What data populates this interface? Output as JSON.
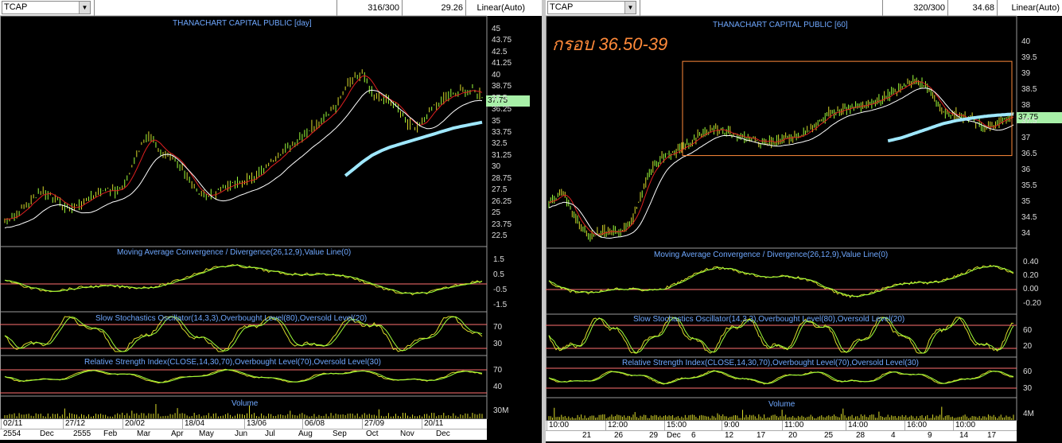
{
  "colors": {
    "price": "#9dff3a",
    "ma_fast": "#e02020",
    "ma_mid": "#ffffff",
    "ma_long": "#9fe8ff",
    "indicator": "#dada2a",
    "indicator2": "#9dff3a",
    "level": "#ff6f6f",
    "title": "#6fa8ff",
    "volume": "#dada2a",
    "annotation": "#ff8a3a",
    "price_tag": "#a8f0a8"
  },
  "left": {
    "symbol": "TCAP",
    "count": "316/300",
    "last": "29.26",
    "scale": "Linear(Auto)",
    "title": "THANACHART CAPITAL PUBLIC [day]",
    "price_tag": "37.75",
    "price_ticks": [
      "45",
      "43.75",
      "42.5",
      "41.25",
      "40",
      "38.75",
      "37.5",
      "36.25",
      "35",
      "33.75",
      "32.5",
      "31.25",
      "30",
      "28.75",
      "27.5",
      "26.25",
      "25",
      "23.75",
      "22.5"
    ],
    "macd_title": "Moving Average Convergence / Divergence(26,12,9),Value Line(0)",
    "macd_ticks": [
      "1.5",
      "0.5",
      "-0.5",
      "-1.5"
    ],
    "stoch_title": "Slow Stochastics Oscillator(14,3,3),Overbought Level(80),Oversold Level(20)",
    "stoch_ticks": [
      "70",
      "30"
    ],
    "rsi_title": "Relative Strength Index(CLOSE,14,30,70),Overbought Level(70),Oversold Level(30)",
    "rsi_ticks": [
      "70",
      "40"
    ],
    "vol_title": "Volume",
    "vol_ticks": [
      "30M"
    ],
    "x_top": [
      "02/11",
      "27/12",
      "20/02",
      "18/04",
      "13/06",
      "06/08",
      "27/09",
      "20/11"
    ],
    "x_bottom": [
      "2554",
      "Dec",
      "2555",
      "Feb",
      "Mar",
      "Apr",
      "May",
      "Jun",
      "Jul",
      "Aug",
      "Sep",
      "Oct",
      "Nov",
      "Dec"
    ]
  },
  "right": {
    "symbol": "TCAP",
    "count": "320/300",
    "last": "34.68",
    "scale": "Linear(Auto)",
    "title": "THANACHART CAPITAL PUBLIC [60]",
    "annotation": "กรอบ 36.50-39",
    "price_tag": "37.75",
    "price_ticks": [
      "40",
      "39.5",
      "39",
      "38.5",
      "38",
      "37.5",
      "37",
      "36.5",
      "36",
      "35.5",
      "35",
      "34.5",
      "34"
    ],
    "macd_title": "Moving Average Convergence / Divergence(26,12,9),Value Line(0)",
    "macd_ticks": [
      "0.40",
      "0.20",
      "0.00",
      "-0.20"
    ],
    "stoch_title": "Slow Stochastics Oscillator(14,3,3),Overbought Level(80),Oversold Level(20)",
    "stoch_ticks": [
      "60",
      "20"
    ],
    "rsi_title": "Relative Strength Index(CLOSE,14,30,70),Overbought Level(70),Oversold Level(30)",
    "rsi_ticks": [
      "60",
      "30"
    ],
    "vol_title": "Volume",
    "vol_ticks": [
      "4M"
    ],
    "x_top": [
      "10:00",
      "12:00",
      "15:00",
      "9:00",
      "11:00",
      "14:00",
      "16:00",
      "10:00"
    ],
    "x_bottom": [
      "21",
      "26",
      "29",
      "Dec",
      "6",
      "12",
      "17",
      "20",
      "25",
      "28",
      "4",
      "9",
      "14",
      "17"
    ]
  },
  "chart_data": [
    {
      "type": "line",
      "title": "THANACHART CAPITAL PUBLIC [day]",
      "ylim": [
        22.5,
        45
      ],
      "series": [
        {
          "name": "price",
          "values": [
            24.3,
            24.8,
            25.5,
            26.6,
            27.4,
            27.0,
            26.1,
            25.4,
            25.9,
            26.6,
            27.2,
            27.6,
            27.3,
            28.2,
            30.5,
            32.8,
            33.2,
            31.6,
            31.4,
            30.3,
            28.4,
            27.3,
            26.8,
            27.3,
            28.0,
            28.2,
            28.4,
            28.9,
            29.6,
            30.6,
            31.5,
            32.4,
            33.1,
            33.9,
            34.9,
            35.6,
            36.6,
            38.3,
            39.8,
            40.4,
            38.2,
            37.4,
            37.2,
            36.0,
            34.6,
            34.3,
            35.6,
            36.9,
            37.6,
            37.9,
            38.3,
            38.4,
            37.75
          ]
        },
        {
          "name": "ma_long",
          "values": [
            null,
            null,
            null,
            null,
            null,
            null,
            null,
            null,
            null,
            null,
            null,
            null,
            null,
            null,
            null,
            null,
            null,
            null,
            null,
            null,
            null,
            null,
            null,
            null,
            null,
            null,
            null,
            null,
            null,
            null,
            null,
            null,
            null,
            null,
            null,
            null,
            null,
            29.0,
            29.8,
            30.6,
            31.3,
            31.8,
            32.2,
            32.5,
            32.8,
            33.1,
            33.4,
            33.7,
            34.0,
            34.3,
            34.5,
            34.7,
            34.9
          ]
        }
      ]
    },
    {
      "type": "line",
      "title": "THANACHART CAPITAL PUBLIC [60]",
      "ylim": [
        33.8,
        40.2
      ],
      "series": [
        {
          "name": "price",
          "values": [
            35.0,
            35.3,
            34.4,
            33.9,
            34.1,
            34.0,
            34.5,
            35.8,
            36.4,
            36.6,
            36.8,
            37.2,
            37.3,
            37.1,
            37.0,
            36.9,
            36.9,
            37.0,
            37.1,
            37.4,
            37.8,
            37.9,
            38.0,
            38.1,
            38.3,
            38.6,
            38.8,
            38.5,
            37.8,
            37.7,
            37.6,
            37.3,
            37.5,
            37.75
          ]
        },
        {
          "name": "ma_long",
          "values": [
            null,
            null,
            null,
            null,
            null,
            null,
            null,
            null,
            null,
            null,
            null,
            null,
            null,
            null,
            null,
            null,
            null,
            null,
            null,
            null,
            null,
            null,
            null,
            null,
            36.9,
            37.0,
            37.15,
            37.3,
            37.45,
            37.55,
            37.62,
            37.68,
            37.72,
            37.75
          ]
        }
      ]
    }
  ]
}
